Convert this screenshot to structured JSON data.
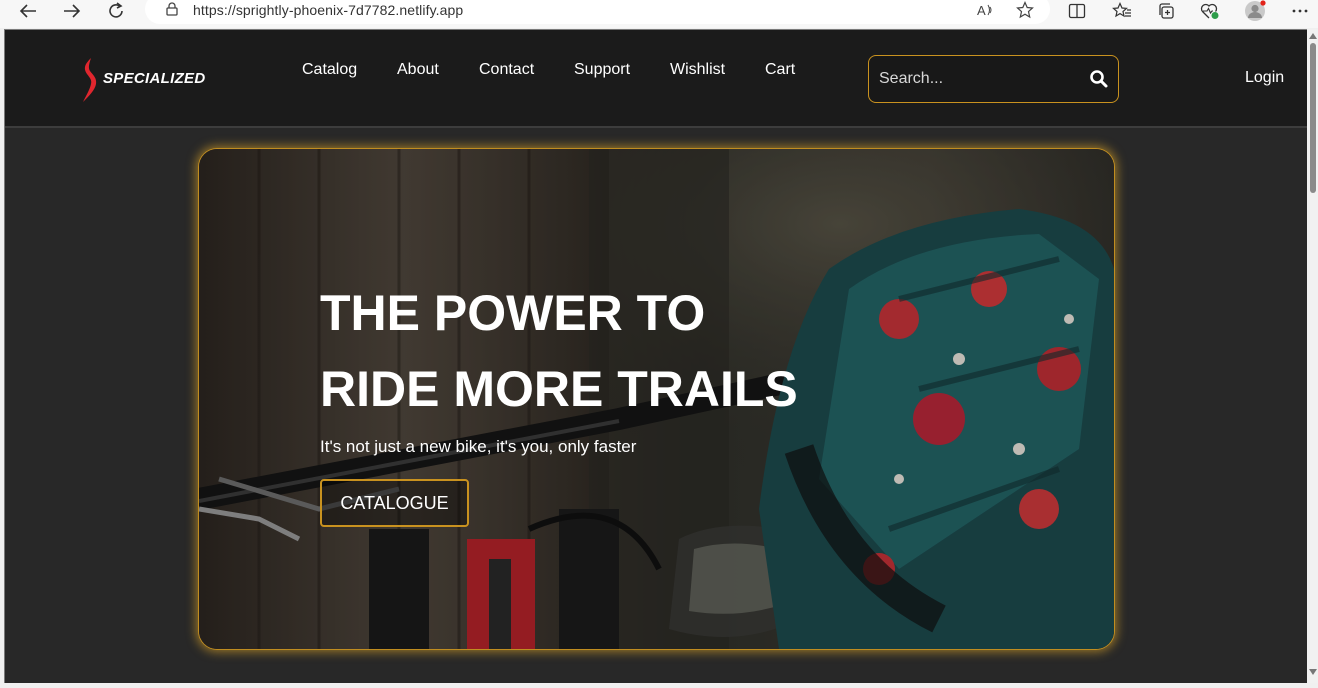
{
  "browser": {
    "url": "https://sprightly-phoenix-7d7782.netlify.app"
  },
  "site": {
    "brand": "SPECIALIZED",
    "accent_color": "#c9921f",
    "nav": [
      {
        "label": "Catalog"
      },
      {
        "label": "About"
      },
      {
        "label": "Contact"
      },
      {
        "label": "Support"
      },
      {
        "label": "Wishlist"
      },
      {
        "label": "Cart"
      }
    ],
    "search": {
      "placeholder": "Search...",
      "value": ""
    },
    "login_label": "Login"
  },
  "hero": {
    "title_line1": "THE POWER TO",
    "title_line2": "RIDE MORE TRAILS",
    "subtitle": "It's not just a new bike, it's you, only faster",
    "cta_label": "CATALOGUE"
  }
}
